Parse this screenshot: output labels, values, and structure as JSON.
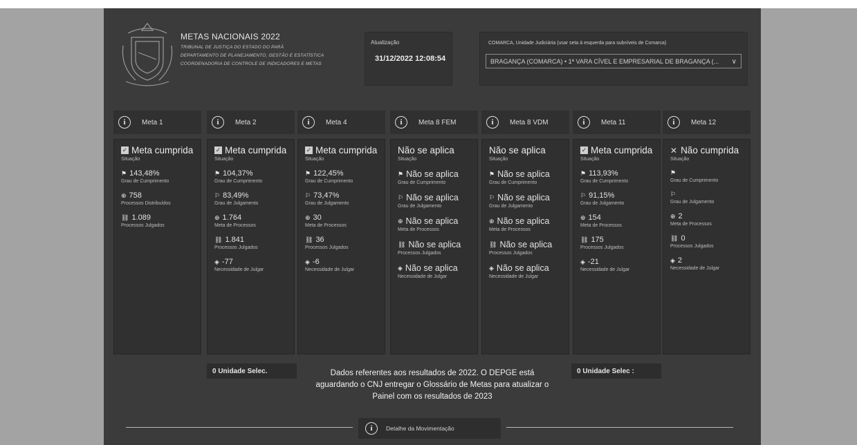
{
  "header": {
    "title": "METAS NACIONAIS 2022",
    "subtitles": [
      "TRIBUNAL DE JUSTIÇA DO ESTADO DO PARÁ",
      "DEPARTAMENTO DE PLANEJAMENTO, GESTÃO E ESTATÍSTICA",
      "COORDENADORIA DE CONTROLE DE INDICADORES E METAS"
    ]
  },
  "update": {
    "label": "Atualização",
    "value": "31/12/2022 12:08:54"
  },
  "comarca": {
    "label": "COMARCA, Unidade Judiciária (usar seta à esquerda para subníveis de Comarca)",
    "selected": "BRAGANÇA (COMARCA) • 1ª VARA CÍVEL E EMPRESARIAL DE BRAGANÇA (..."
  },
  "metas": [
    {
      "name": "Meta 1",
      "status": "Meta cumprida",
      "status_kind": "check",
      "status_label": "Situação",
      "metrics": [
        {
          "icon": "flag-filled",
          "glyph": "⚑",
          "value": "143,48%",
          "label": "Grau de Cumprimento"
        },
        {
          "icon": "scale",
          "glyph": "⊕",
          "value": "758",
          "label": "Processos Distribuídos"
        },
        {
          "icon": "gavel",
          "glyph": "⛓",
          "value": "1.089",
          "label": "Processos Julgados"
        }
      ]
    },
    {
      "name": "Meta 2",
      "status": "Meta cumprida",
      "status_kind": "check",
      "status_label": "Situação",
      "metrics": [
        {
          "icon": "flag-filled",
          "glyph": "⚑",
          "value": "104,37%",
          "label": "Grau de Cumprimento"
        },
        {
          "icon": "flag-outline",
          "glyph": "⚐",
          "value": "83,49%",
          "label": "Grau de Julgamento"
        },
        {
          "icon": "scale",
          "glyph": "⊕",
          "value": "1.764",
          "label": "Meta de Processos"
        },
        {
          "icon": "gavel",
          "glyph": "⛓",
          "value": "1.841",
          "label": "Processos Julgados"
        },
        {
          "icon": "diamond",
          "glyph": "◈",
          "value": "-77",
          "label": "Necessidade de Julgar"
        }
      ]
    },
    {
      "name": "Meta 4",
      "status": "Meta cumprida",
      "status_kind": "check",
      "status_label": "Situação",
      "metrics": [
        {
          "icon": "flag-filled",
          "glyph": "⚑",
          "value": "122,45%",
          "label": "Grau de Cumprimento"
        },
        {
          "icon": "flag-outline",
          "glyph": "⚐",
          "value": "73,47%",
          "label": "Grau de Julgamento"
        },
        {
          "icon": "scale",
          "glyph": "⊕",
          "value": "30",
          "label": "Meta de Processos"
        },
        {
          "icon": "gavel",
          "glyph": "⛓",
          "value": "36",
          "label": "Processos Julgados"
        },
        {
          "icon": "diamond",
          "glyph": "◈",
          "value": "-6",
          "label": "Necessidade de Julgar"
        }
      ]
    },
    {
      "name": "Meta 8 FEM",
      "status": "Não se aplica",
      "status_kind": "none",
      "status_label": "Situação",
      "metrics": [
        {
          "icon": "flag-filled",
          "glyph": "⚑",
          "value": "Não se aplica",
          "label": "Grau de Cumprimento"
        },
        {
          "icon": "flag-outline",
          "glyph": "⚐",
          "value": "Não se aplica",
          "label": "Grau de Julgamento"
        },
        {
          "icon": "scale",
          "glyph": "⊕",
          "value": "Não se aplica",
          "label": "Meta de Processos"
        },
        {
          "icon": "gavel",
          "glyph": "⛓",
          "value": "Não se aplica",
          "label": "Processos Julgados"
        },
        {
          "icon": "diamond",
          "glyph": "◈",
          "value": "Não se aplica",
          "label": "Necessidade de Julgar"
        }
      ]
    },
    {
      "name": "Meta 8 VDM",
      "status": "Não se aplica",
      "status_kind": "none",
      "status_label": "Situação",
      "metrics": [
        {
          "icon": "flag-filled",
          "glyph": "⚑",
          "value": "Não se aplica",
          "label": "Grau de Cumprimento"
        },
        {
          "icon": "flag-outline",
          "glyph": "⚐",
          "value": "Não se aplica",
          "label": "Grau de Julgamento"
        },
        {
          "icon": "scale",
          "glyph": "⊕",
          "value": "Não se aplica",
          "label": "Meta de Processos"
        },
        {
          "icon": "gavel",
          "glyph": "⛓",
          "value": "Não se aplica",
          "label": "Processos Julgados"
        },
        {
          "icon": "diamond",
          "glyph": "◈",
          "value": "Não se aplica",
          "label": "Necessidade de Julgar"
        }
      ]
    },
    {
      "name": "Meta 11",
      "status": "Meta cumprida",
      "status_kind": "check",
      "status_label": "Situação",
      "metrics": [
        {
          "icon": "flag-filled",
          "glyph": "⚑",
          "value": "113,93%",
          "label": "Grau de Cumprimento"
        },
        {
          "icon": "flag-outline",
          "glyph": "⚐",
          "value": "91,15%",
          "label": "Grau de Julgamento"
        },
        {
          "icon": "scale",
          "glyph": "⊕",
          "value": "154",
          "label": "Meta de Processos"
        },
        {
          "icon": "gavel",
          "glyph": "⛓",
          "value": "175",
          "label": "Processos Julgados"
        },
        {
          "icon": "diamond",
          "glyph": "◈",
          "value": "-21",
          "label": "Necessidade de Julgar"
        }
      ]
    },
    {
      "name": "Meta 12",
      "status": "Não cumprida",
      "status_kind": "x",
      "status_label": "Situação",
      "metrics": [
        {
          "icon": "flag-filled",
          "glyph": "⚑",
          "value": "",
          "label": "Grau de Cumprimento"
        },
        {
          "icon": "flag-outline",
          "glyph": "⚐",
          "value": "",
          "label": "Grau de Julgamento"
        },
        {
          "icon": "scale",
          "glyph": "⊕",
          "value": "2",
          "label": "Meta de Processos"
        },
        {
          "icon": "gavel",
          "glyph": "⛓",
          "value": "0",
          "label": "Processos Julgados"
        },
        {
          "icon": "diamond",
          "glyph": "◈",
          "value": "2",
          "label": "Necessidade de Julgar"
        }
      ]
    }
  ],
  "unit_selectors": [
    "0 Unidade Selec.",
    "0 Unidade Selec :"
  ],
  "notice": "Dados referentes aos resultados de 2022. O DEPGE está aguardando o CNJ entregar o Glossário de Metas para atualizar o Painel com os resultados de 2023",
  "footer": {
    "detail_label": "Detalhe da Movimentação"
  },
  "colors": {
    "background": "#3b3b3b",
    "panel": "#303030",
    "gutter": "#a3a3a3",
    "text": "#e6e6e6"
  }
}
